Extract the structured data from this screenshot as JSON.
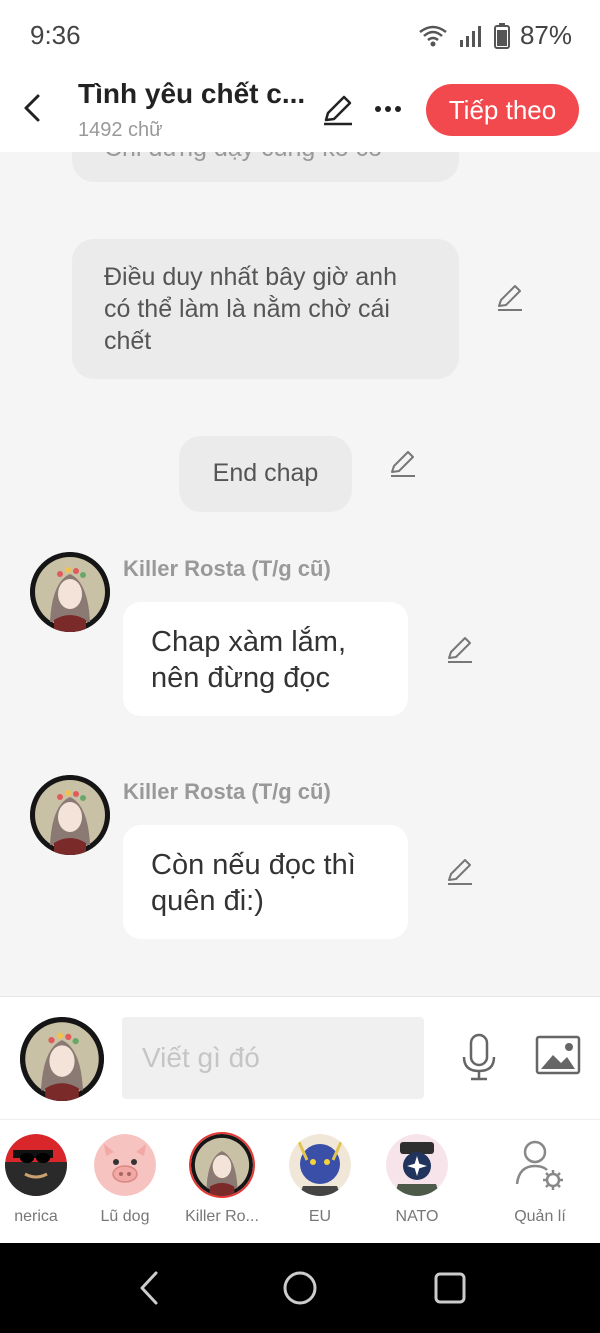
{
  "status_bar": {
    "time": "9:36",
    "battery": "87%",
    "icons": [
      "wifi-icon",
      "signal-icon",
      "battery-icon"
    ]
  },
  "header": {
    "title": "Tình yêu chết c...",
    "subtitle": "1492 chữ",
    "next_label": "Tiếp theo",
    "more_label": "···",
    "accent_color": "#f2494e"
  },
  "chat": {
    "partial_bubble_text": "Chỉ đứng dậy cũng ko có",
    "messages": [
      {
        "type": "narration",
        "text": "Điều duy nhất bây giờ anh có thể làm là nằm chờ cái chết"
      },
      {
        "type": "narration",
        "text": "End chap"
      },
      {
        "type": "character",
        "sender": "Killer Rosta (T/g cũ)",
        "text": "Chap xàm lắm, nên đừng đọc"
      },
      {
        "type": "character",
        "sender": "Killer Rosta (T/g cũ)",
        "text": "Còn nếu đọc thì quên đi:)"
      }
    ]
  },
  "input": {
    "placeholder": "Viết gì đó",
    "icons": [
      "microphone-icon",
      "image-icon"
    ]
  },
  "characters": [
    {
      "label": "nerica"
    },
    {
      "label": "Lũ dog"
    },
    {
      "label": "Killer Ro..."
    },
    {
      "label": "EU"
    },
    {
      "label": "NATO"
    },
    {
      "label": "Quản lí"
    }
  ],
  "colors": {
    "background": "#f5f5f5",
    "narration_bubble": "#ebebeb",
    "dialog_bubble": "#ffffff",
    "selected_ring": "#e53935"
  }
}
